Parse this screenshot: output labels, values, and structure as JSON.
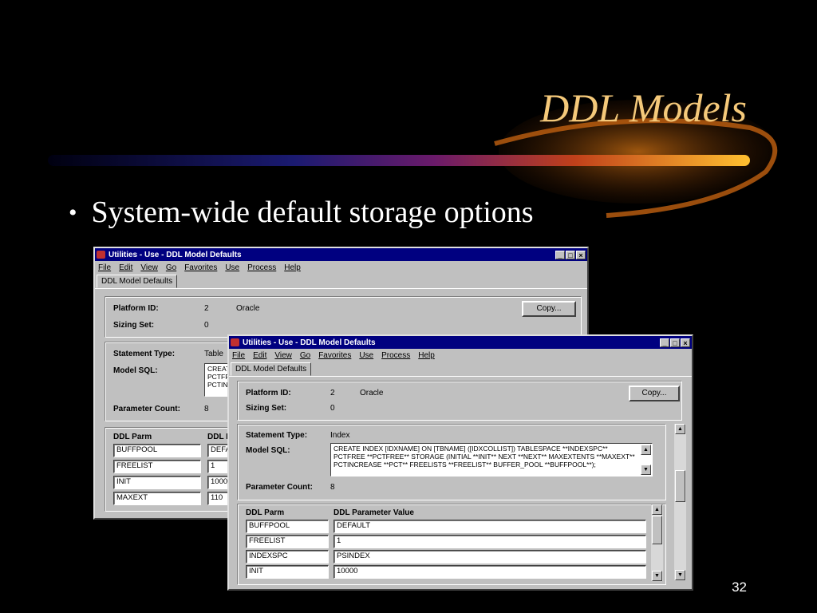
{
  "slide": {
    "title": "DDL Models",
    "bullet": "System-wide default storage options",
    "page_number": "32"
  },
  "back_window": {
    "title": "Utilities - Use - DDL Model Defaults",
    "menu": [
      "File",
      "Edit",
      "View",
      "Go",
      "Favorites",
      "Use",
      "Process",
      "Help"
    ],
    "tab": "DDL Model Defaults",
    "platform_id_label": "Platform ID:",
    "platform_id": "2",
    "platform_name": "Oracle",
    "copy_button": "Copy...",
    "sizing_set_label": "Sizing Set:",
    "sizing_set": "0",
    "statement_type_label": "Statement Type:",
    "statement_type": "Table",
    "model_sql_label": "Model SQL:",
    "model_sql_lines": [
      "CREAT",
      "PCTFF",
      "PCTIN"
    ],
    "parameter_count_label": "Parameter Count:",
    "parameter_count": "8",
    "col_parm": "DDL Parm",
    "col_value": "DDL I",
    "rows": [
      {
        "parm": "BUFFPOOL",
        "value": "DEFA"
      },
      {
        "parm": "FREELIST",
        "value": "1"
      },
      {
        "parm": "INIT",
        "value": "1000"
      },
      {
        "parm": "MAXEXT",
        "value": "110"
      }
    ]
  },
  "front_window": {
    "title": "Utilities - Use - DDL Model Defaults",
    "menu": [
      "File",
      "Edit",
      "View",
      "Go",
      "Favorites",
      "Use",
      "Process",
      "Help"
    ],
    "tab": "DDL Model Defaults",
    "platform_id_label": "Platform ID:",
    "platform_id": "2",
    "platform_name": "Oracle",
    "copy_button": "Copy...",
    "sizing_set_label": "Sizing Set:",
    "sizing_set": "0",
    "statement_type_label": "Statement Type:",
    "statement_type": "Index",
    "model_sql_label": "Model SQL:",
    "model_sql_lines": [
      "CREATE INDEX [IDXNAME] ON [TBNAME] ([IDXCOLLIST]) TABLESPACE **INDEXSPC**",
      "PCTFREE **PCTFREE** STORAGE (INITIAL **INIT** NEXT **NEXT** MAXEXTENTS **MAXEXT**",
      "PCTINCREASE **PCT** FREELISTS **FREELIST** BUFFER_POOL **BUFFPOOL**);"
    ],
    "parameter_count_label": "Parameter Count:",
    "parameter_count": "8",
    "col_parm": "DDL Parm",
    "col_value": "DDL Parameter Value",
    "rows": [
      {
        "parm": "BUFFPOOL",
        "value": "DEFAULT"
      },
      {
        "parm": "FREELIST",
        "value": "1"
      },
      {
        "parm": "INDEXSPC",
        "value": "PSINDEX"
      },
      {
        "parm": "INIT",
        "value": "10000"
      }
    ]
  }
}
